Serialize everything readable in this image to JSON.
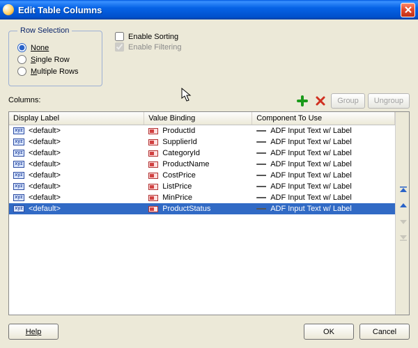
{
  "window": {
    "title": "Edit Table Columns"
  },
  "rowSelection": {
    "legend": "Row Selection",
    "options": {
      "none": "None",
      "single": "Single Row",
      "multiple": "Multiple Rows"
    },
    "selected": "none"
  },
  "checks": {
    "enableSorting": {
      "label": "Enable Sorting",
      "checked": false
    },
    "enableFiltering": {
      "label": "Enable Filtering",
      "checked": true,
      "disabled": true
    }
  },
  "columnsLabel": "Columns:",
  "toolbar": {
    "group": "Group",
    "ungroup": "Ungroup"
  },
  "table": {
    "headers": {
      "displayLabel": "Display Label",
      "valueBinding": "Value Binding",
      "componentToUse": "Component To Use"
    },
    "rows": [
      {
        "displayLabel": "<default>",
        "valueBinding": "ProductId",
        "component": "ADF Input Text w/ Label",
        "selected": false
      },
      {
        "displayLabel": "<default>",
        "valueBinding": "SupplierId",
        "component": "ADF Input Text w/ Label",
        "selected": false
      },
      {
        "displayLabel": "<default>",
        "valueBinding": "CategoryId",
        "component": "ADF Input Text w/ Label",
        "selected": false
      },
      {
        "displayLabel": "<default>",
        "valueBinding": "ProductName",
        "component": "ADF Input Text w/ Label",
        "selected": false
      },
      {
        "displayLabel": "<default>",
        "valueBinding": "CostPrice",
        "component": "ADF Input Text w/ Label",
        "selected": false
      },
      {
        "displayLabel": "<default>",
        "valueBinding": "ListPrice",
        "component": "ADF Input Text w/ Label",
        "selected": false
      },
      {
        "displayLabel": "<default>",
        "valueBinding": "MinPrice",
        "component": "ADF Input Text w/ Label",
        "selected": false
      },
      {
        "displayLabel": "<default>",
        "valueBinding": "ProductStatus",
        "component": "ADF Input Text w/ Label",
        "selected": true
      }
    ]
  },
  "buttons": {
    "help": "Help",
    "ok": "OK",
    "cancel": "Cancel"
  }
}
